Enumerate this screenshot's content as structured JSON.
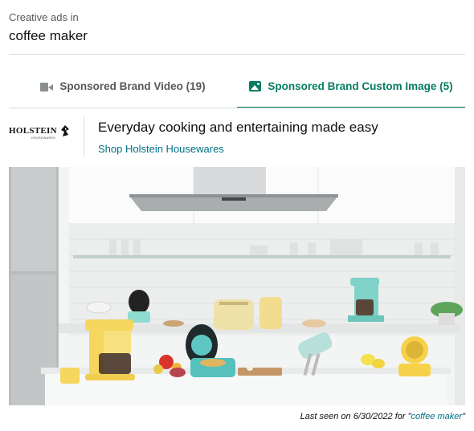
{
  "header": {
    "subtitle": "Creative ads in",
    "keyword": "coffee maker"
  },
  "tabs": [
    {
      "label": "Sponsored Brand Video (19)",
      "icon": "video-camera-icon",
      "active": false
    },
    {
      "label": "Sponsored Brand Custom Image (5)",
      "icon": "image-icon",
      "active": true
    }
  ],
  "ad": {
    "brand_logo_text": "HOLSTEIN",
    "brand_logo_subtext": "HOUSEWARES",
    "headline": "Everyday cooking and entertaining made easy",
    "link_text": "Shop Holstein Housewares",
    "image_description_icon": "kitchen-appliances-photo"
  },
  "footer": {
    "prefix": "Last seen on 6/30/2022 for ",
    "quote_open": "\"",
    "keyword": "coffee maker",
    "quote_close": "\""
  },
  "colors": {
    "accent": "#067d62",
    "link": "#007185",
    "muted": "#565959",
    "divider": "#d5d9d9"
  }
}
